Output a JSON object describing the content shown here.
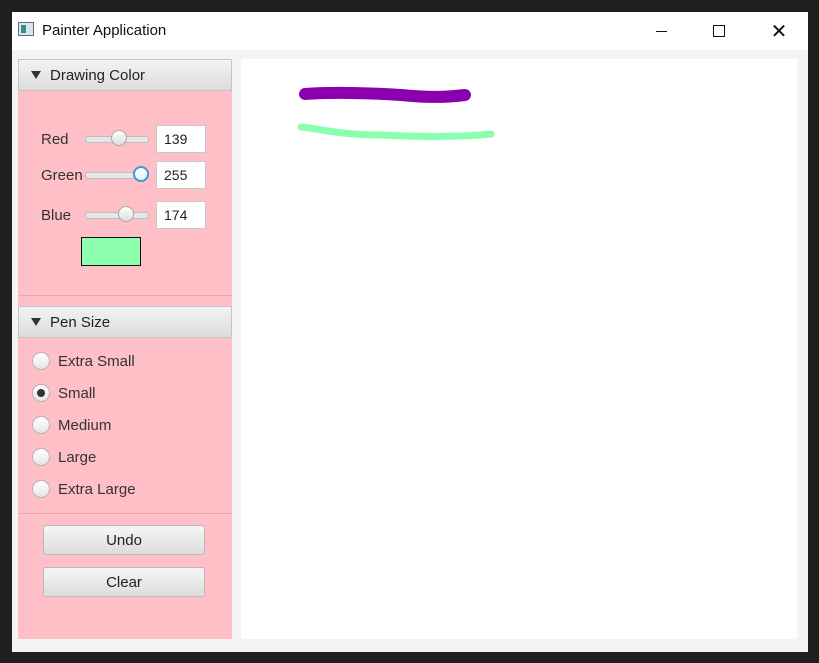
{
  "window": {
    "title": "Painter Application",
    "controls": {
      "minimize": "minimize",
      "maximize": "maximize",
      "close": "✕"
    }
  },
  "drawing_color": {
    "header": "Drawing Color",
    "channels": [
      {
        "label": "Red",
        "value": "139",
        "fraction": 0.545
      },
      {
        "label": "Green",
        "value": "255",
        "fraction": 1.0
      },
      {
        "label": "Blue",
        "value": "174",
        "fraction": 0.682
      }
    ],
    "swatch_color": "#8BFFAE"
  },
  "pen_size": {
    "header": "Pen Size",
    "options": [
      {
        "label": "Extra Small",
        "checked": false
      },
      {
        "label": "Small",
        "checked": true
      },
      {
        "label": "Medium",
        "checked": false
      },
      {
        "label": "Large",
        "checked": false
      },
      {
        "label": "Extra Large",
        "checked": false
      }
    ]
  },
  "buttons": {
    "undo": "Undo",
    "clear": "Clear"
  },
  "strokes": [
    {
      "color": "#8B00AE"
    },
    {
      "color": "#8BFFAE"
    }
  ],
  "colors": {
    "panel_background": "#FFBFC6",
    "canvas_background": "#FFFFFF"
  }
}
